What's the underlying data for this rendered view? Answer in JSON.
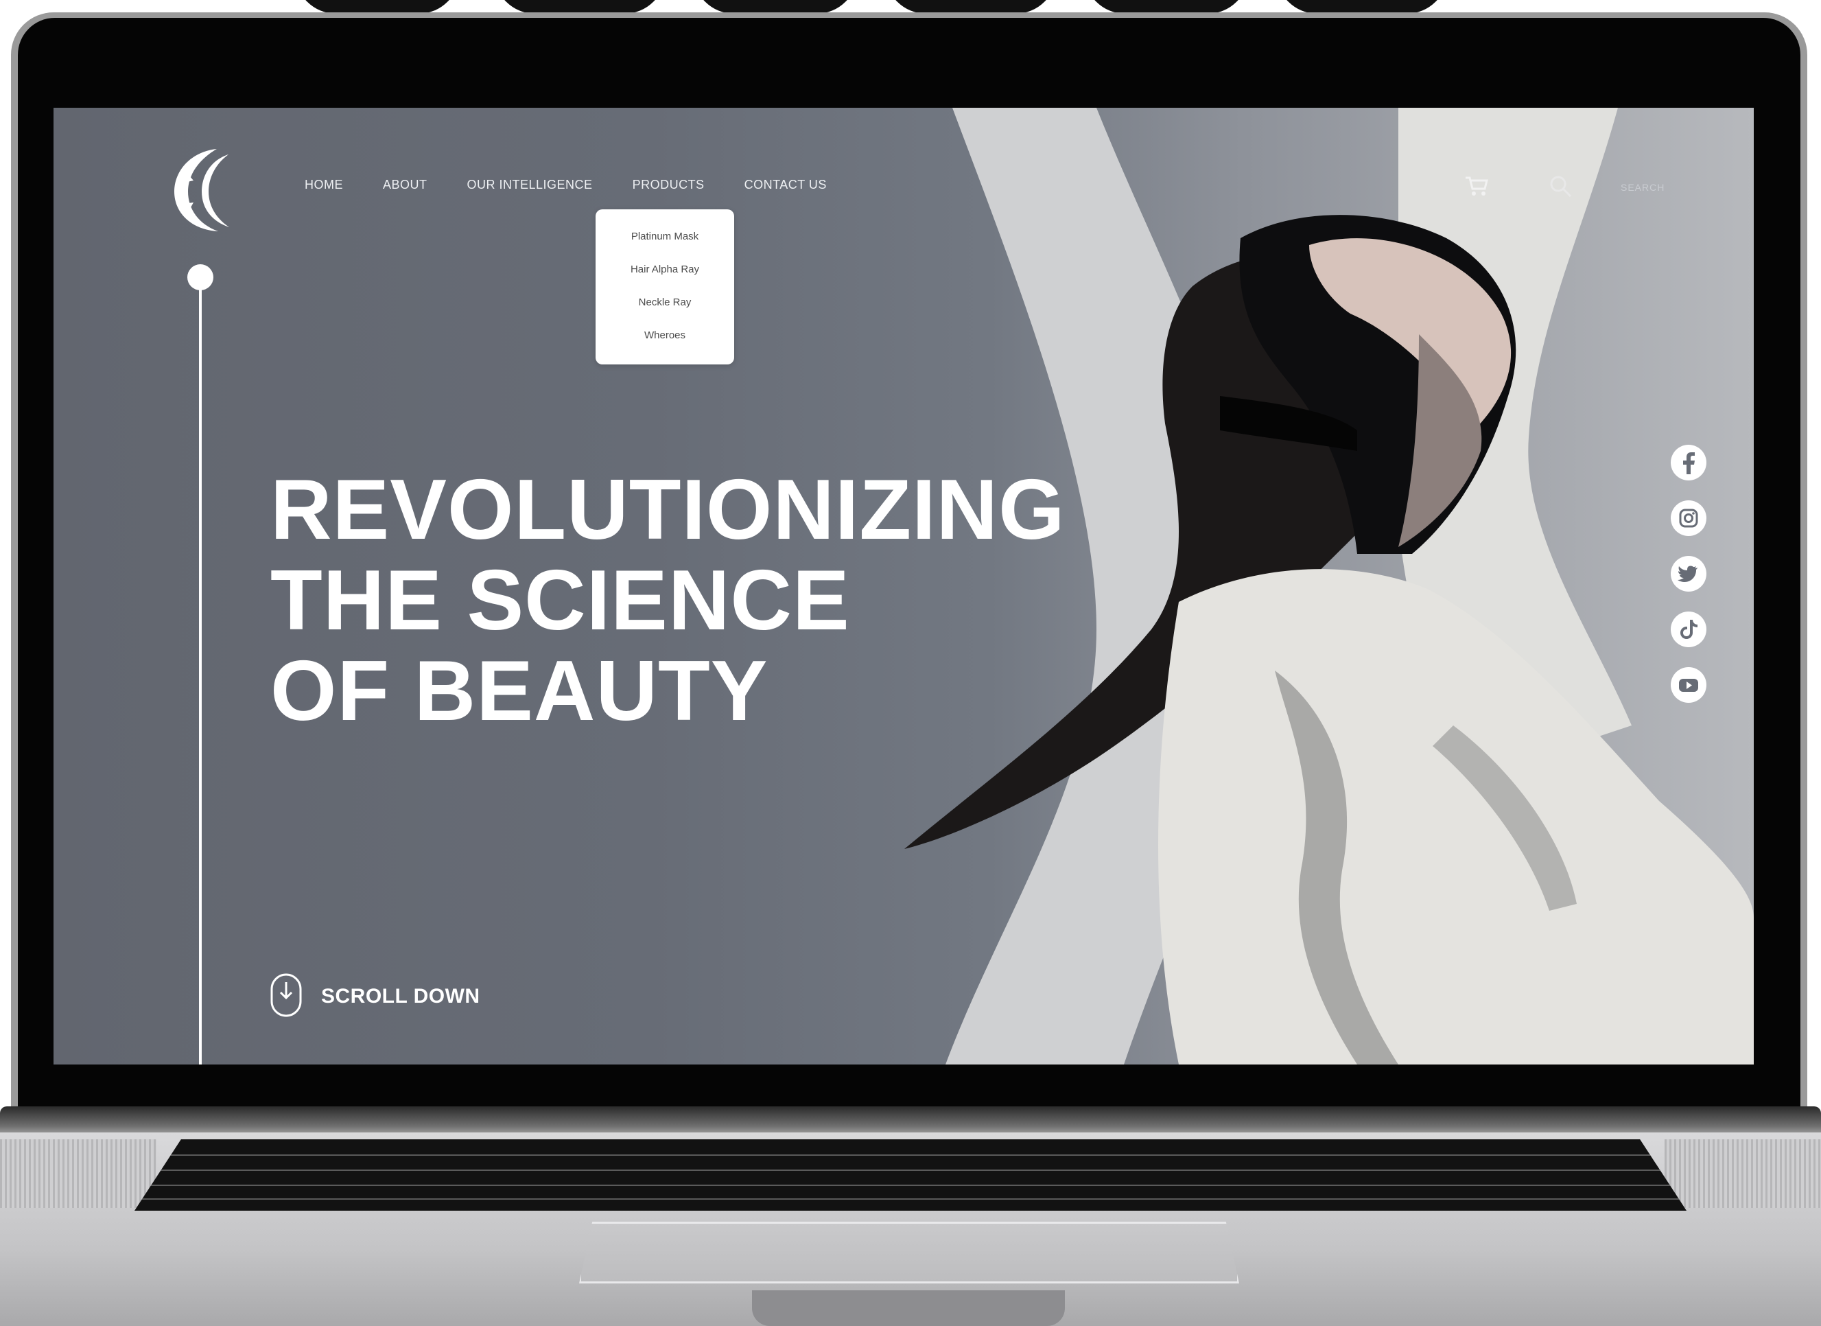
{
  "nav": {
    "items": [
      {
        "label": "HOME"
      },
      {
        "label": "ABOUT"
      },
      {
        "label": "OUR INTELLIGENCE"
      },
      {
        "label": "PRODUCTS"
      },
      {
        "label": "CONTACT US"
      }
    ],
    "search_label": "SEARCH"
  },
  "products_menu": {
    "items": [
      {
        "label": "Platinum Mask"
      },
      {
        "label": "Hair Alpha Ray"
      },
      {
        "label": "Neckle Ray"
      },
      {
        "label": "Wheroes"
      }
    ]
  },
  "hero": {
    "lines": [
      "REVOLUTIONIZING",
      "THE SCIENCE",
      "OF BEAUTY"
    ]
  },
  "scroll": {
    "label": "SCROLL DOWN"
  },
  "social": {
    "icons": [
      "facebook-icon",
      "instagram-icon",
      "twitter-icon",
      "tiktok-icon",
      "youtube-icon"
    ]
  },
  "colors": {
    "background": "#676c76",
    "text": "#ffffff",
    "dropdown_bg": "#ffffff"
  }
}
